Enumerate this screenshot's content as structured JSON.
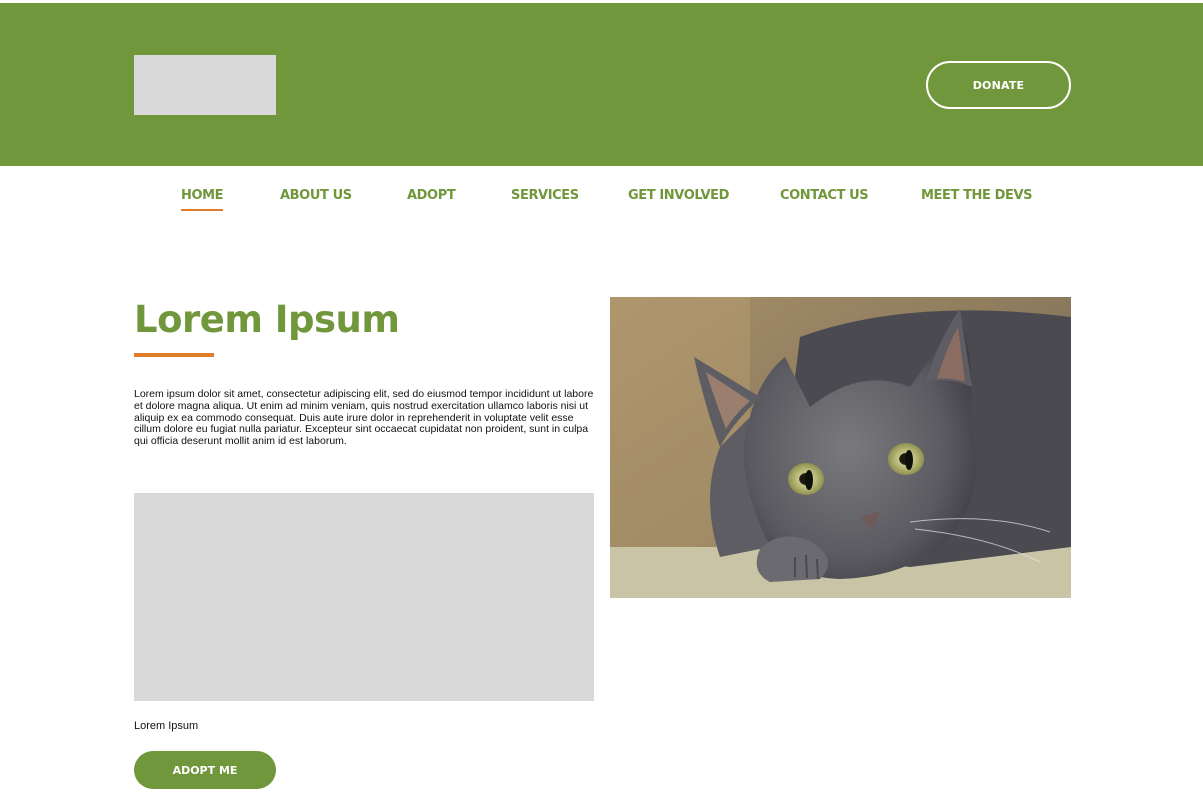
{
  "header": {
    "donate_label": "DONATE"
  },
  "nav": {
    "items": [
      {
        "label": "HOME"
      },
      {
        "label": "ABOUT US"
      },
      {
        "label": "ADOPT"
      },
      {
        "label": "SERVICES"
      },
      {
        "label": "GET INVOLVED"
      },
      {
        "label": "CONTACT US"
      },
      {
        "label": "MEET THE DEVS"
      }
    ],
    "active": "HOME"
  },
  "main": {
    "title": "Lorem Ipsum",
    "body": "Lorem ipsum dolor sit amet, consectetur adipiscing elit, sed do eiusmod tempor incididunt ut labore et dolore magna aliqua. Ut enim ad minim veniam, quis nostrud exercitation ullamco laboris nisi ut aliquip ex ea commodo consequat. Duis aute irure dolor in reprehenderit in voluptate velit esse cillum dolore eu fugiat nulla pariatur. Excepteur sint occaecat cupidatat non proident, sunt in culpa qui officia deserunt mollit anim id est laborum.",
    "caption": "Lorem Ipsum",
    "adopt_label": "ADOPT ME"
  },
  "colors": {
    "brand_green": "#70973b",
    "accent_orange": "#e07b2a",
    "placeholder_gray": "#d9d9d9"
  }
}
